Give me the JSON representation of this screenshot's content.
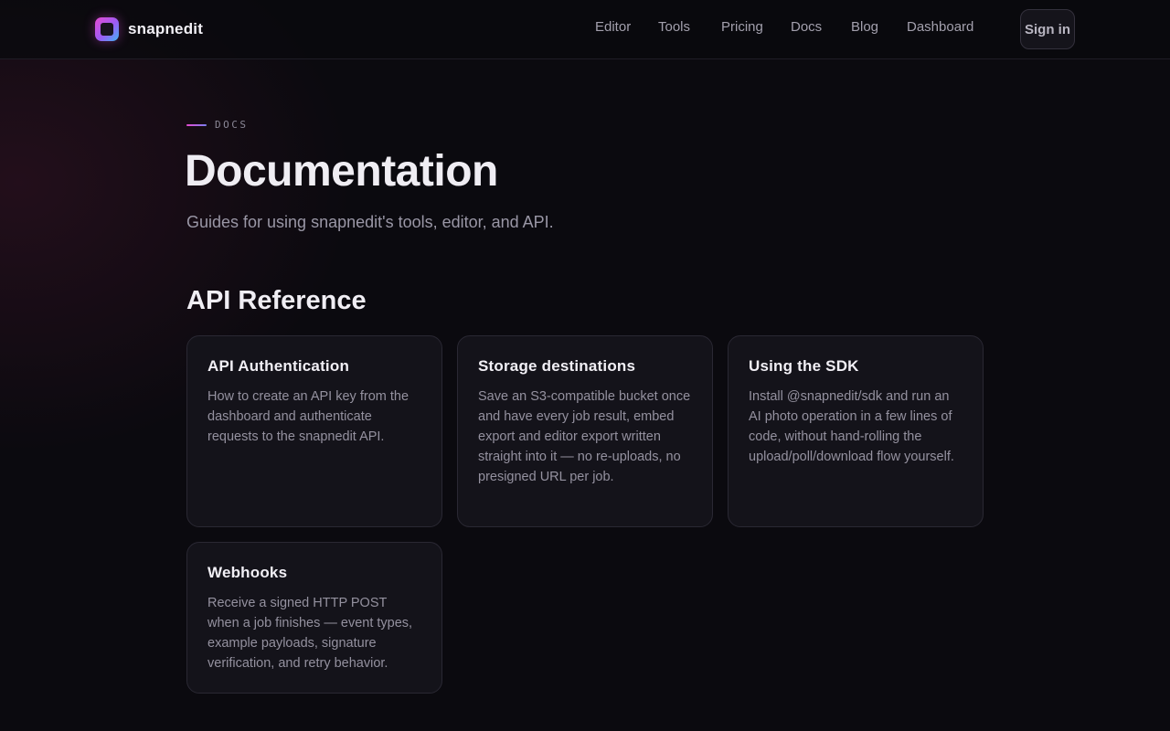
{
  "header": {
    "brand": "snapnedit",
    "nav": [
      "Editor",
      "Tools",
      "Pricing",
      "Docs",
      "Blog",
      "Dashboard"
    ],
    "signin_label": "Sign in"
  },
  "hero": {
    "eyebrow": "DOCS",
    "title": "Documentation",
    "subtitle": "Guides for using snapnedit's tools, editor, and API."
  },
  "section": {
    "title": "API Reference",
    "cards": [
      {
        "title": "API Authentication",
        "description": "How to create an API key from the dashboard and authenticate requests to the snapnedit API."
      },
      {
        "title": "Storage destinations",
        "description": "Save an S3-compatible bucket once and have every job result, embed export and editor export written straight into it — no re-uploads, no presigned URL per job."
      },
      {
        "title": "Using the SDK",
        "description": "Install @snapnedit/sdk and run an AI photo operation in a few lines of code, without hand-rolling the upload/poll/download flow yourself."
      },
      {
        "title": "Webhooks",
        "description": "Receive a signed HTTP POST when a job finishes — event types, example payloads, signature verification, and retry behavior."
      }
    ]
  },
  "colors": {
    "background": "#0b0a0f",
    "card": "#14131a",
    "accent_gradient_start": "#e64bd1",
    "accent_gradient_end": "#3fb6f0"
  }
}
